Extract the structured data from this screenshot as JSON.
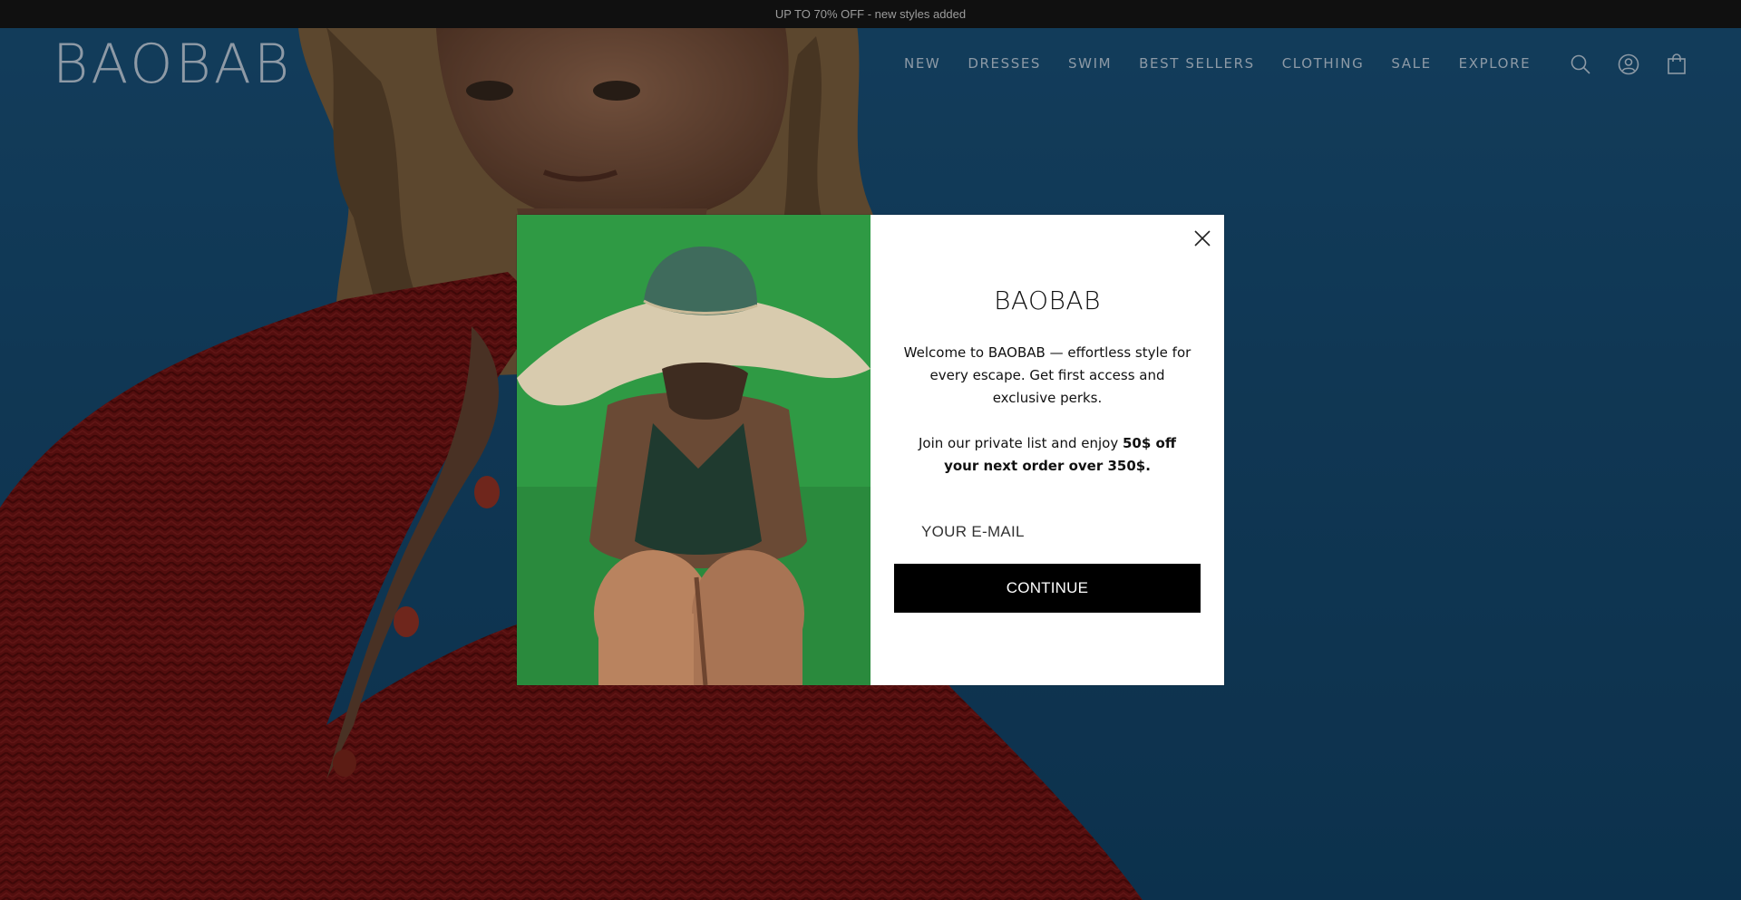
{
  "announcement": {
    "text": "UP TO 70% OFF - new styles added"
  },
  "header": {
    "logo": "BAOBAB",
    "nav": [
      {
        "label": "NEW"
      },
      {
        "label": "DRESSES"
      },
      {
        "label": "SWIM"
      },
      {
        "label": "BEST SELLERS"
      },
      {
        "label": "CLOTHING"
      },
      {
        "label": "SALE"
      },
      {
        "label": "EXPLORE"
      }
    ],
    "icons": [
      "search-icon",
      "account-icon",
      "cart-bag-icon"
    ]
  },
  "popup": {
    "logo": "BAOBAB",
    "intro": "Welcome to BAOBAB — effortless style for every escape. Get first access and exclusive perks.",
    "offer_prefix": "Join our private list and enjoy ",
    "offer_bold": "50$ off your next order over 350$.",
    "email_placeholder": "YOUR E-MAIL",
    "email_value": "",
    "button_label": "CONTINUE",
    "close_icon": "close-icon"
  },
  "colors": {
    "announcement_bg": "#101010",
    "hero_blue": "#18527d",
    "knit_red": "#7a1414",
    "popup_image_green": "#2f9a44",
    "button_black": "#000000"
  }
}
